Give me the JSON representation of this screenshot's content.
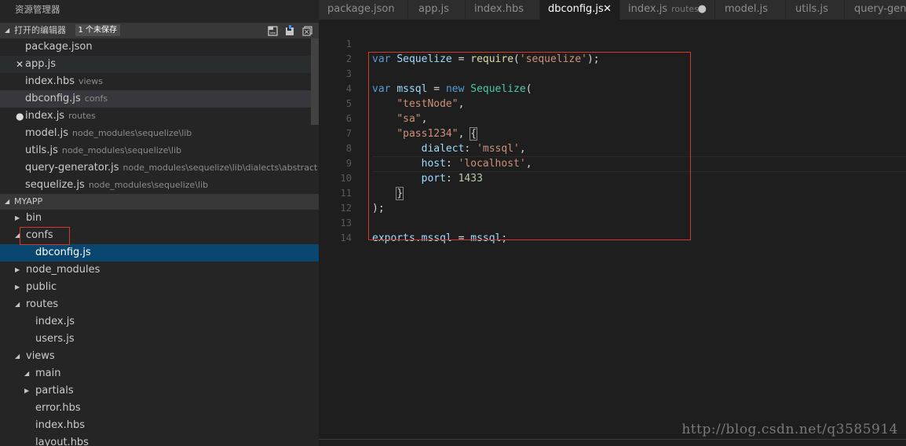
{
  "explorer": {
    "title": "资源管理器",
    "open_editors": {
      "header": "打开的编辑器",
      "badge": "1 个未保存",
      "items": [
        {
          "name": "package.json",
          "desc": ""
        },
        {
          "name": "app.js",
          "desc": "",
          "mark": "✕"
        },
        {
          "name": "index.hbs",
          "desc": "views"
        },
        {
          "name": "dbconfig.js",
          "desc": "confs"
        },
        {
          "name": "index.js",
          "desc": "routes",
          "mark": "●"
        },
        {
          "name": "model.js",
          "desc": "node_modules\\sequelize\\lib"
        },
        {
          "name": "utils.js",
          "desc": "node_modules\\sequelize\\lib"
        },
        {
          "name": "query-generator.js",
          "desc": "node_modules\\sequelize\\lib\\dialects\\abstract"
        },
        {
          "name": "sequelize.js",
          "desc": "node_modules\\sequelize\\lib"
        }
      ]
    },
    "project": {
      "header": "MYAPP",
      "tree": [
        {
          "label": "bin",
          "twist": "collapsed"
        },
        {
          "label": "confs",
          "twist": "expanded"
        },
        {
          "label": "dbconfig.js",
          "twist": "none"
        },
        {
          "label": "node_modules",
          "twist": "collapsed"
        },
        {
          "label": "public",
          "twist": "collapsed"
        },
        {
          "label": "routes",
          "twist": "expanded"
        },
        {
          "label": "index.js",
          "twist": "none"
        },
        {
          "label": "users.js",
          "twist": "none"
        },
        {
          "label": "views",
          "twist": "expanded"
        },
        {
          "label": "main",
          "twist": "expanded"
        },
        {
          "label": "partials",
          "twist": "collapsed"
        },
        {
          "label": "error.hbs",
          "twist": "none"
        },
        {
          "label": "index.hbs",
          "twist": "none"
        },
        {
          "label": "layout.hbs",
          "twist": "none"
        }
      ]
    }
  },
  "tabs": [
    {
      "label": "package.json",
      "desc": ""
    },
    {
      "label": "app.js",
      "desc": ""
    },
    {
      "label": "index.hbs",
      "desc": ""
    },
    {
      "label": "dbconfig.js",
      "desc": "",
      "close": "✕"
    },
    {
      "label": "index.js",
      "desc": "routes",
      "dot": "●"
    },
    {
      "label": "model.js",
      "desc": ""
    },
    {
      "label": "utils.js",
      "desc": ""
    },
    {
      "label": "query-generator.js",
      "desc": ""
    }
  ],
  "code": {
    "line_numbers": [
      "1",
      "2",
      "3",
      "4",
      "5",
      "6",
      "7",
      "8",
      "9",
      "10",
      "11",
      "12",
      "13",
      "14"
    ],
    "l1": {
      "kw": "var",
      "name": "Sequelize",
      "eq": " = ",
      "fn": "require",
      "open": "(",
      "str": "'sequelize'",
      "close": ");"
    },
    "l3": {
      "kw": "var",
      "name": "mssql",
      "eq": " = ",
      "kw2": "new",
      "cls": "Sequelize",
      "open": "("
    },
    "l4": {
      "str": "\"testNode\"",
      "punct": ","
    },
    "l5": {
      "str": "\"sa\"",
      "punct": ","
    },
    "l6": {
      "str": "\"pass1234\"",
      "punct": ", ",
      "brace": "{"
    },
    "l7": {
      "prop": "dialect",
      "colon": ": ",
      "str": "'mssql'",
      "punct": ","
    },
    "l8": {
      "prop": "host",
      "colon": ": ",
      "str": "'localhost'",
      "punct": ","
    },
    "l9": {
      "prop": "port",
      "colon": ": ",
      "num": "1433"
    },
    "l10": {
      "brace": "}"
    },
    "l11": {
      "text": ");"
    },
    "l13": {
      "prop": "exports",
      "dot": ".",
      "prop2": "mssql",
      "eq": " = ",
      "name": "mssql",
      "semi": ";"
    }
  },
  "watermark": "http://blog.csdn.net/q3585914",
  "colors": {
    "keyword": "#569cd6",
    "class": "#4ec9b0",
    "string": "#ce9178",
    "number": "#b5cea8",
    "property": "#9cdcfe",
    "highlight_box": "#d33a2c",
    "selected_row": "#094771"
  }
}
